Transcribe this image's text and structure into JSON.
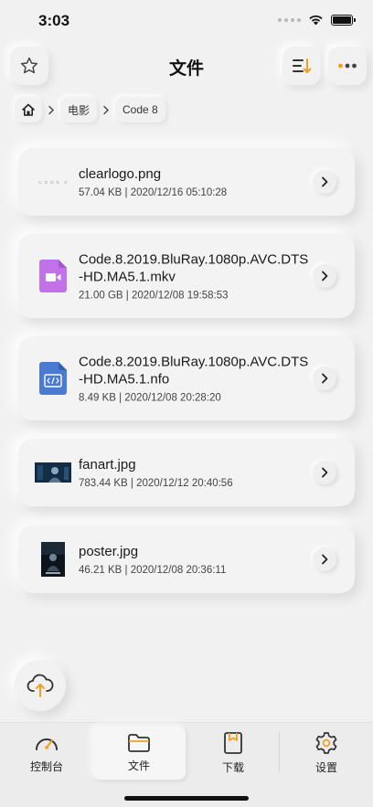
{
  "status_bar": {
    "time": "3:03"
  },
  "header": {
    "title": "文件"
  },
  "breadcrumb": {
    "items": [
      "电影",
      "Code 8"
    ]
  },
  "files": [
    {
      "name": "clearlogo.png",
      "meta": "57.04 KB | 2020/12/16 05:10:28",
      "thumb_text": "C O D E  8"
    },
    {
      "name": "Code.8.2019.BluRay.1080p.AVC.DTS-HD.MA5.1.mkv",
      "meta": "21.00 GB | 2020/12/08 19:58:53"
    },
    {
      "name": "Code.8.2019.BluRay.1080p.AVC.DTS-HD.MA5.1.nfo",
      "meta": "8.49 KB | 2020/12/08 20:28:20"
    },
    {
      "name": "fanart.jpg",
      "meta": "783.44 KB | 2020/12/12 20:40:56"
    },
    {
      "name": "poster.jpg",
      "meta": "46.21 KB | 2020/12/08 20:36:11"
    }
  ],
  "tabs": [
    {
      "label": "控制台",
      "icon": "dashboard-icon"
    },
    {
      "label": "文件",
      "icon": "folder-icon",
      "active": true
    },
    {
      "label": "下载",
      "icon": "download-file-icon"
    },
    {
      "label": "设置",
      "icon": "settings-icon"
    }
  ],
  "colors": {
    "accent": "#f0a020",
    "video": "#c272e8",
    "document": "#4a7bd0",
    "background": "#f1f1f1"
  }
}
